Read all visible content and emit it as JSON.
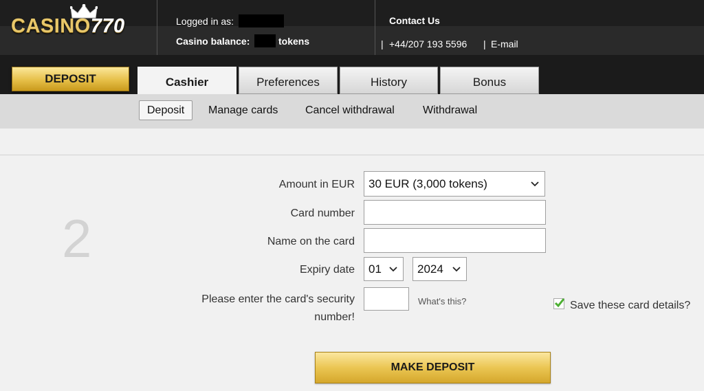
{
  "header": {
    "logo_text": "CASINO",
    "logo_number": "770",
    "logged_in_label": "Logged in as:",
    "balance_label": "Casino balance:",
    "balance_unit": "tokens",
    "contact_title": "Contact Us",
    "phone": "+44/207 193 5596",
    "email_label": "E-mail",
    "pipe": "|"
  },
  "tabs": {
    "deposit_button": "DEPOSIT",
    "items": [
      {
        "label": "Cashier",
        "active": true
      },
      {
        "label": "Preferences",
        "active": false
      },
      {
        "label": "History",
        "active": false
      },
      {
        "label": "Bonus",
        "active": false
      }
    ]
  },
  "subnav": {
    "items": [
      {
        "label": "Deposit",
        "active": true
      },
      {
        "label": "Manage cards",
        "active": false
      },
      {
        "label": "Cancel withdrawal",
        "active": false
      },
      {
        "label": "Withdrawal",
        "active": false
      }
    ]
  },
  "form": {
    "step_number": "2",
    "amount_label": "Amount in EUR",
    "amount_value": "30 EUR (3,000 tokens)",
    "card_number_label": "Card number",
    "card_number_value": "",
    "name_label": "Name on the card",
    "name_value": "",
    "expiry_label": "Expiry date",
    "expiry_month": "01",
    "expiry_year": "2024",
    "security_label_line1": "Please enter the card's security",
    "security_label_line2": "number!",
    "security_value": "",
    "whats_this": "What's this?",
    "save_card_label": "Save these card details?",
    "save_card_checked": true,
    "submit_label": "MAKE DEPOSIT"
  },
  "colors": {
    "header_bg": "#1e1e1e",
    "gold": "#e6bf48",
    "check_green": "#4caf32"
  },
  "icons": [
    "crown-icon",
    "chevron-down-icon",
    "checkmark-icon"
  ]
}
